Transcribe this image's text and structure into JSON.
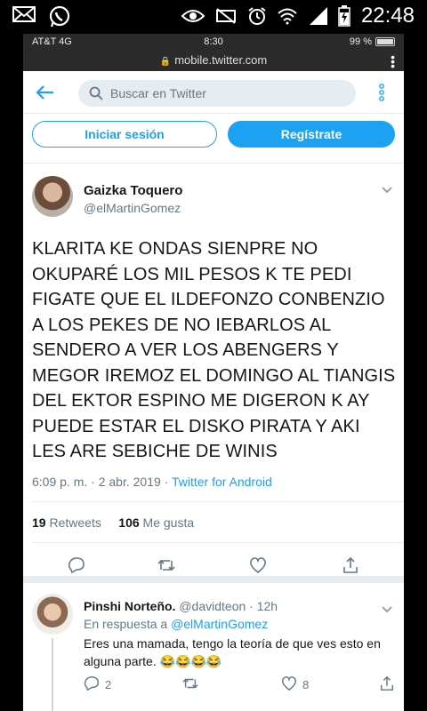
{
  "android_status": {
    "time": "22:48",
    "left_icons": [
      "mail-icon",
      "whatsapp-icon"
    ],
    "right_icons": [
      "eye-icon",
      "mute-icon",
      "alarm-icon",
      "wifi-icon",
      "signal-icon",
      "battery-charging-icon"
    ]
  },
  "ios_status": {
    "carrier": "AT&T 4G",
    "time": "8:30",
    "battery": "99 %"
  },
  "browser": {
    "url": "mobile.twitter.com"
  },
  "header": {
    "search_placeholder": "Buscar en Twitter"
  },
  "auth": {
    "login_label": "Iniciar sesión",
    "signup_label": "Regístrate"
  },
  "tweet": {
    "display_name": "Gaizka Toquero",
    "handle": "@elMartinGomez",
    "text": "KLARITA KE ONDAS SIENPRE NO OKUPARÉ LOS MIL PESOS K TE PEDI FIGATE QUE EL ILDEFONZO CONBENZIO A LOS PEKES DE NO IEBARLOS AL SENDERO A VER LOS ABENGERS Y MEGOR IREMOZ EL DOMINGO AL TIANGIS DEL EKTOR ESPINO ME DIGERON K AY PUEDE ESTAR EL DISKO PIRATA Y AKI LES ARE SEBICHE DE WINIS",
    "timestamp": "6:09 p. m. · 2 abr. 2019 · ",
    "source": "Twitter for Android",
    "retweets_count": "19",
    "retweets_label": "Retweets",
    "likes_count": "106",
    "likes_label": "Me gusta"
  },
  "reply": {
    "display_name": "Pinshi Norteño.",
    "handle_time": "@davidteon · 12h",
    "replying_prefix": "En respuesta a ",
    "replying_to": "@elMartinGomez",
    "text": "Eres una mamada, tengo la teoría de que ves esto en alguna parte. 😂😂😂😂",
    "reply_count": "2",
    "like_count": "8"
  },
  "colors": {
    "accent": "#1da1f2",
    "text": "#14171a",
    "muted": "#657786"
  }
}
